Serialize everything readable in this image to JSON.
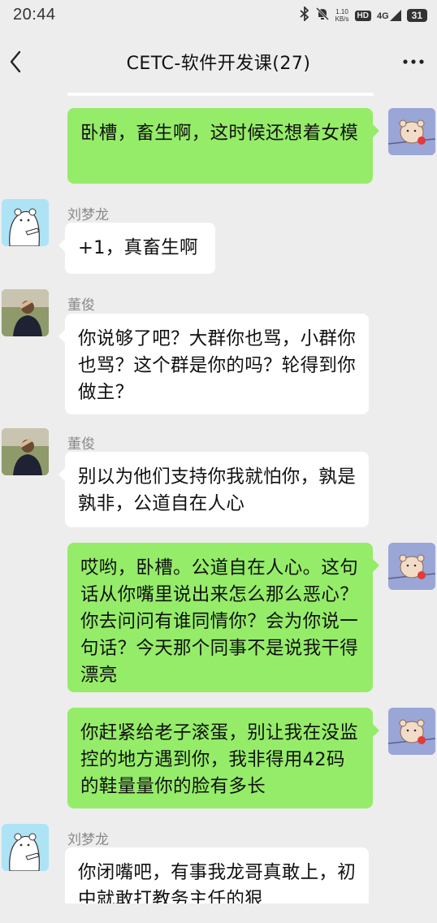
{
  "status_bar": {
    "time": "20:44",
    "net_speed_value": "1.10",
    "net_speed_unit": "KB/s",
    "hd": "HD",
    "signal": "4G",
    "battery": "31",
    "icons": [
      "bluetooth-icon",
      "mute-icon",
      "hd-icon",
      "signal-icon",
      "battery-icon"
    ]
  },
  "header": {
    "title": "CETC-软件开发课(27)",
    "back_icon": "chevron-left-icon",
    "more_icon": "more-dots-icon"
  },
  "messages": [
    {
      "side": "out",
      "sender": "",
      "text": "卧槽，畜生啊，这时候还想着女模"
    },
    {
      "side": "in",
      "sender": "刘梦龙",
      "text": "+1，真畜生啊"
    },
    {
      "side": "in",
      "sender": "董俊",
      "text": "你说够了吧？大群你也骂，小群你也骂？这个群是你的吗？轮得到你做主？"
    },
    {
      "side": "in",
      "sender": "董俊",
      "text": "别以为他们支持你我就怕你，孰是孰非，公道自在人心"
    },
    {
      "side": "out",
      "sender": "",
      "text": "哎哟，卧槽。公道自在人心。这句话从你嘴里说出来怎么那么恶心？你去问问有谁同情你？会为你说一句话？今天那个同事不是说我干得漂亮"
    },
    {
      "side": "out",
      "sender": "",
      "text": "你赶紧给老子滚蛋，别让我在没监控的地方遇到你，我非得用42码的鞋量量你的脸有多长"
    },
    {
      "side": "in",
      "sender": "刘梦龙",
      "text": "你闭嘴吧，有事我龙哥真敢上，初中就敢打教务主任的狠"
    }
  ],
  "colors": {
    "background": "#ededed",
    "bubble_out": "#95ec69",
    "bubble_in": "#ffffff",
    "sender_name": "#8a8a8a"
  }
}
